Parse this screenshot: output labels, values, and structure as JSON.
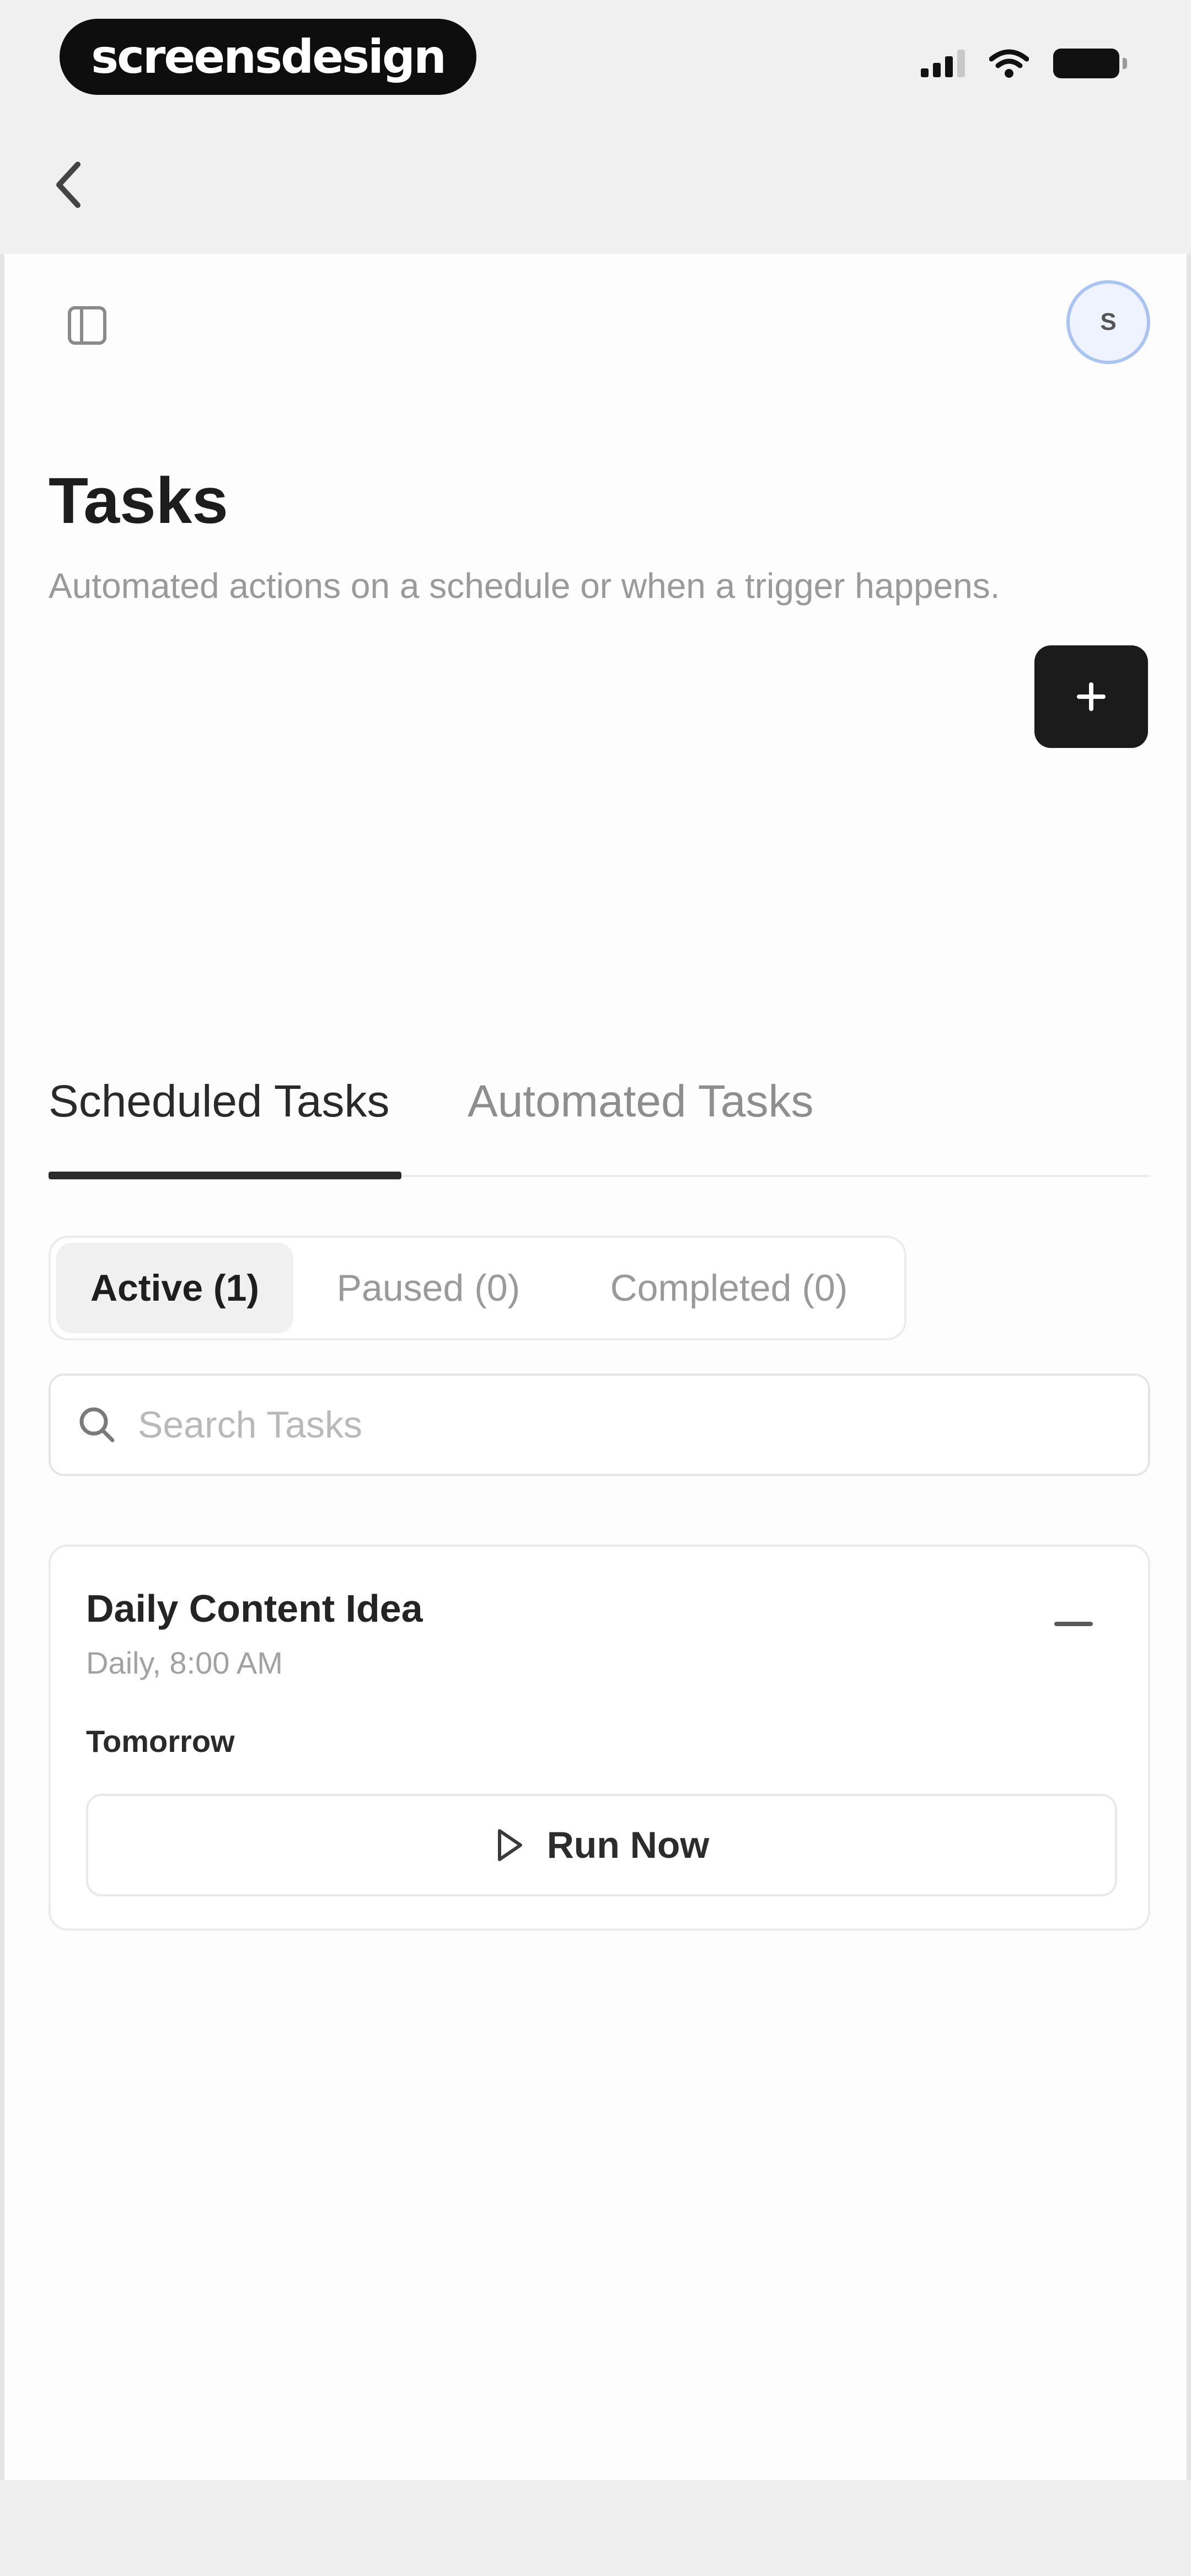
{
  "status_bar": {
    "brand": "screensdesign"
  },
  "header": {
    "avatar_initial": "S"
  },
  "page": {
    "title": "Tasks",
    "subtitle": "Automated actions on a schedule or when a trigger happens."
  },
  "tabs": [
    {
      "label": "Scheduled Tasks",
      "selected": true
    },
    {
      "label": "Automated Tasks",
      "selected": false
    }
  ],
  "filters": [
    {
      "label": "Active (1)",
      "selected": true
    },
    {
      "label": "Paused (0)",
      "selected": false
    },
    {
      "label": "Completed (0)",
      "selected": false
    }
  ],
  "search": {
    "placeholder": "Search Tasks",
    "value": ""
  },
  "tasks": [
    {
      "title": "Daily Content Idea",
      "schedule": "Daily, 8:00 AM",
      "next_run": "Tomorrow",
      "run_label": "Run Now"
    }
  ],
  "icons": {
    "back": "chevron-left-icon",
    "sidebar": "sidebar-icon",
    "add": "plus-icon",
    "search": "search-icon",
    "menu": "more-icon",
    "run": "play-icon"
  },
  "colors": {
    "background": "#f0f0f0",
    "surface": "#fdfdfd",
    "primary_button": "#1b1b1b",
    "avatar_ring": "#a9c4f3"
  }
}
